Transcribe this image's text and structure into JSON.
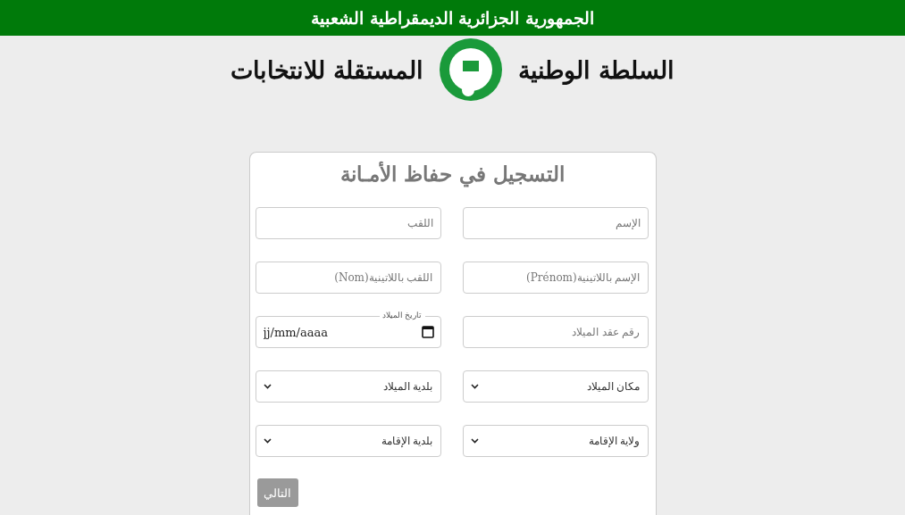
{
  "banner": {
    "title": "الجمهورية الجزائرية الديمقراطية الشعبية"
  },
  "authority": {
    "name_right": "السلطة الوطنية",
    "name_left": "المستقلة للانتخابات"
  },
  "form": {
    "title": "التسجيل في حفاظ الأمـانة",
    "fields": [
      {
        "kind": "text",
        "placeholder": "الإسم"
      },
      {
        "kind": "text",
        "placeholder": "اللقب"
      },
      {
        "kind": "text",
        "placeholder": "الإسم باللاتينية(Prénom)"
      },
      {
        "kind": "text",
        "placeholder": "اللقب باللاتينية(Nom)"
      },
      {
        "kind": "text",
        "placeholder": "رقم عقد الميلاد"
      },
      {
        "kind": "date",
        "label": "تاريخ الميلاد",
        "placeholder": "jj/mm/aaaa"
      },
      {
        "kind": "select",
        "value": "مكان الميلاد"
      },
      {
        "kind": "select",
        "value": "بلدية الميلاد"
      },
      {
        "kind": "select",
        "value": "ولاية الإقامة"
      },
      {
        "kind": "select",
        "value": "بلدية الإقامة"
      }
    ],
    "next_button": {
      "label": "التالي",
      "disabled": true
    }
  }
}
